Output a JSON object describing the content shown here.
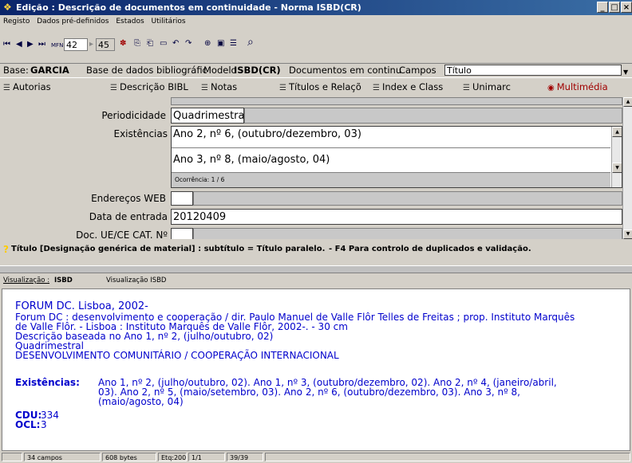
{
  "window": {
    "title": "Edição : Descrição de documentos em continuidade - Norma ISBD(CR)",
    "controls": [
      "_",
      "□",
      "×"
    ]
  },
  "menu": [
    "Registo",
    "Dados pré-definidos",
    "Estados",
    "Utilitários"
  ],
  "toolbar": {
    "mfn_label": "MFN",
    "mfn_value": "42",
    "total_value": "45"
  },
  "basebar": {
    "base_label": "Base:",
    "base_value": "GARCIA",
    "base_desc": "Base de dados bibliográfic",
    "modelo_label": "Modelo",
    "modelo_value": "ISBD(CR)",
    "docs_desc": "Documentos em continu",
    "campos_label": "Campos",
    "campos_value": "Título"
  },
  "tabs": [
    {
      "label": "Autorias"
    },
    {
      "label": "Descrição BIBL"
    },
    {
      "label": "Notas"
    },
    {
      "label": "Títulos e Relaçõ"
    },
    {
      "label": "Index e Class"
    },
    {
      "label": "Unimarc"
    },
    {
      "label": "Multimédia"
    }
  ],
  "form": {
    "periodicidade_label": "Periodicidade",
    "periodicidade_value": "Quadrimestral",
    "existencias_label": "Existências",
    "existencias_values": [
      "Ano 2, nº 6, (outubro/dezembro, 03)",
      "Ano 3, nº 8, (maio/agosto, 04)"
    ],
    "ocorrencia": "Ocorrência: 1 / 6",
    "enderecos_label": "Endereços WEB",
    "data_label": "Data de entrada",
    "data_value": "20120409",
    "doc_label": "Doc. UE/CE CAT.  Nº"
  },
  "hint": {
    "icon": "?",
    "text1": "Título [Designação genérica de material] : subtítulo = Título paralelo.",
    "text2": "- F4 Para controlo de duplicados e validação."
  },
  "vis_tabs": {
    "label": "Visualização :",
    "isbd": "ISBD",
    "isbd_full": "Visualização ISBD"
  },
  "record": {
    "heading": "FORUM DC. Lisboa, 2002-",
    "body": [
      "Forum DC : desenvolvimento e cooperação / dir. Paulo Manuel de Valle Flôr Telles de Freitas ; prop. Instituto Marquês",
      "de Valle Flôr. - Lisboa : Instituto Marquês de Valle Flôr, 2002-. - 30 cm",
      "Descrição baseada no Ano 1, nº 2, (julho/outubro, 02)",
      "Quadrimestral",
      "DESENVOLVIMENTO COMUNITÁRIO / COOPERAÇÃO INTERNACIONAL"
    ],
    "existencias_label": "Existências:",
    "existencias_lines": [
      "Ano 1, nº 2, (julho/outubro, 02). Ano 1, nº 3, (outubro/dezembro, 02). Ano 2, nº 4, (janeiro/abril,",
      "03). Ano 2, nº 5, (maio/setembro, 03). Ano 2, nº 6, (outubro/dezembro, 03). Ano 3, nº 8,",
      "(maio/agosto, 04)"
    ],
    "cdu_label": "CDU:",
    "cdu_value": "334",
    "ocl_label": "OCL:",
    "ocl_value": "3"
  },
  "status": {
    "campos": "34 campos",
    "bytes": "608 bytes",
    "etq": "Etq:200",
    "pos": "1/1",
    "rec": "39/39"
  }
}
